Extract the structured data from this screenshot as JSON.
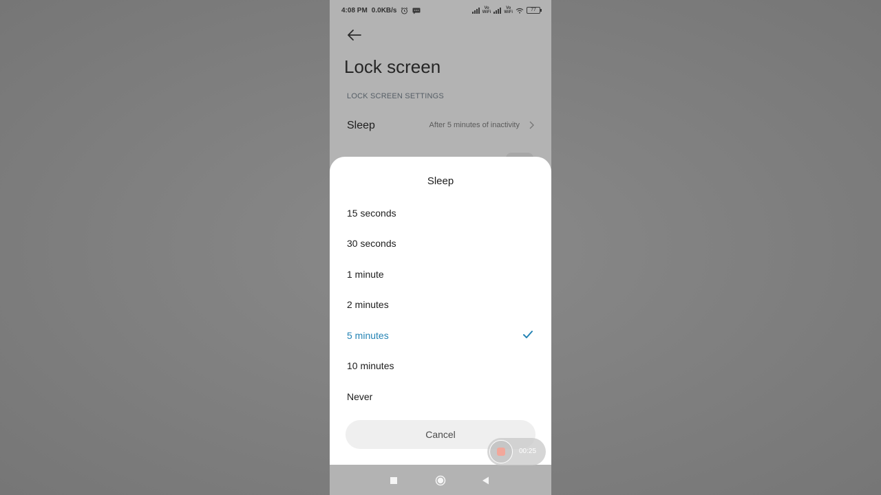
{
  "status_bar": {
    "time": "4:08 PM",
    "speed": "0.0KB/s",
    "network_label_1": "Vo\nWiFi",
    "network_label_2": "Vo\nWiFi",
    "battery": "77"
  },
  "header": {
    "back_icon": "arrow-left-icon",
    "title": "Lock screen"
  },
  "settings": {
    "section_label": "LOCK SCREEN SETTINGS",
    "sleep_label": "Sleep",
    "sleep_value": "After 5 minutes of inactivity"
  },
  "dialog": {
    "title": "Sleep",
    "options": [
      {
        "label": "15 seconds",
        "selected": false
      },
      {
        "label": "30 seconds",
        "selected": false
      },
      {
        "label": "1 minute",
        "selected": false
      },
      {
        "label": "2 minutes",
        "selected": false
      },
      {
        "label": "5 minutes",
        "selected": true
      },
      {
        "label": "10 minutes",
        "selected": false
      },
      {
        "label": "Never",
        "selected": false
      }
    ],
    "cancel_label": "Cancel"
  },
  "recorder": {
    "elapsed": "00:25"
  },
  "colors": {
    "accent": "#2383b4",
    "scrim": "#b3b3b3",
    "sheet": "#ffffff"
  }
}
